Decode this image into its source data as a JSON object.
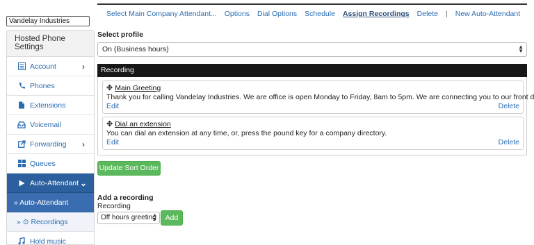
{
  "company": "Vandelay Industries",
  "sidebar": {
    "header": "Hosted Phone Settings",
    "items": [
      {
        "label": "Account",
        "icon": "list-icon",
        "chevron": true
      },
      {
        "label": "Phones",
        "icon": "phone-icon",
        "chevron": false
      },
      {
        "label": "Extensions",
        "icon": "file-icon",
        "chevron": false
      },
      {
        "label": "Voicemail",
        "icon": "inbox-icon",
        "chevron": false
      },
      {
        "label": "Forwarding",
        "icon": "share-icon",
        "chevron": true
      },
      {
        "label": "Queues",
        "icon": "grid-icon",
        "chevron": false
      },
      {
        "label": "Auto-Attendant",
        "icon": "play-icon",
        "chevron": true
      },
      {
        "label": "» Auto-Attendant",
        "icon": "",
        "chevron": false
      },
      {
        "label": "» ⊙ Recordings",
        "icon": "",
        "chevron": false
      },
      {
        "label": "Hold music",
        "icon": "music-icon",
        "chevron": false
      }
    ]
  },
  "nav": {
    "items": [
      "Select Main Company Attendant...",
      "Options",
      "Dial Options",
      "Schedule",
      "Assign Recordings",
      "Delete",
      "|",
      "New Auto-Attendant"
    ],
    "current": "Assign Recordings"
  },
  "profile": {
    "label": "Select profile",
    "value": "On (Business hours)"
  },
  "recording": {
    "header": "Recording",
    "items": [
      {
        "name": "Main Greeting",
        "text": "Thank you for calling Vandelay Industries. We are office is open Monday to Friday, 8am to 5pm. We are connecting you to our front desk.",
        "edit": "Edit",
        "delete": "Delete"
      },
      {
        "name": "Dial an extension",
        "text": "You can dial an extension at any time, or, press the pound key for a company directory.",
        "edit": "Edit",
        "delete": "Delete"
      }
    ]
  },
  "buttons": {
    "update_sort": "Update Sort Order",
    "add": "Add"
  },
  "add_recording": {
    "title": "Add a recording",
    "label": "Recording",
    "selected": "Off hours greeting"
  },
  "colors": {
    "link": "#2a6cb0",
    "active_sidebar": "#2c5f9e",
    "green_button": "#5cb85c",
    "header_bar": "#171717"
  }
}
